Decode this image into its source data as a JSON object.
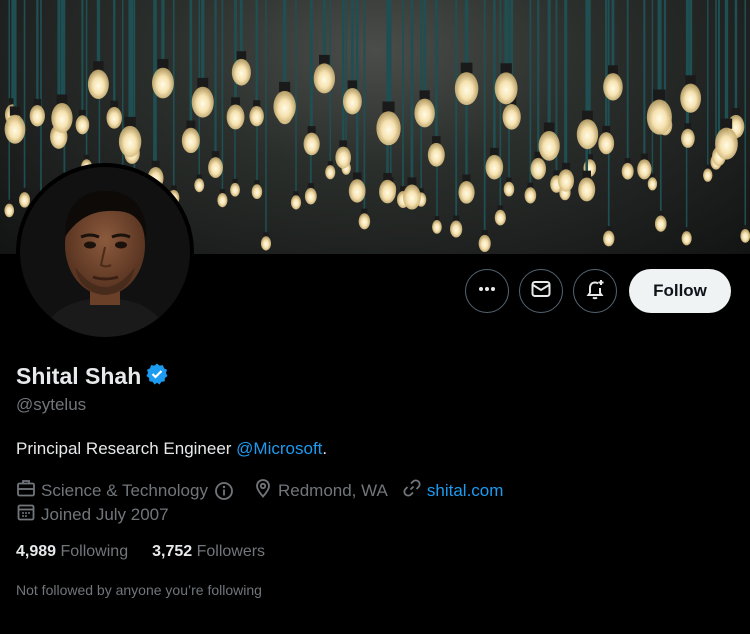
{
  "profile": {
    "name": "Shital Shah",
    "handle": "@sytelus",
    "bio_text": "Principal Research Engineer ",
    "bio_mention": "@Microsoft",
    "bio_suffix": ".",
    "category": "Science & Technology",
    "location": "Redmond, WA",
    "website": "shital.com",
    "joined": "Joined July 2007",
    "following_count": "4,989",
    "following_label": "Following",
    "followers_count": "3,752",
    "followers_label": "Followers",
    "not_followed_text": "Not followed by anyone you’re following"
  },
  "actions": {
    "follow_label": "Follow"
  },
  "colors": {
    "accent": "#1d9bf0",
    "verified": "#1d9bf0",
    "muted": "#71767b"
  },
  "icons": [
    "more-icon",
    "message-icon",
    "notification-bell-icon",
    "verified-icon",
    "briefcase-icon",
    "info-icon",
    "location-pin-icon",
    "link-icon",
    "calendar-icon"
  ]
}
